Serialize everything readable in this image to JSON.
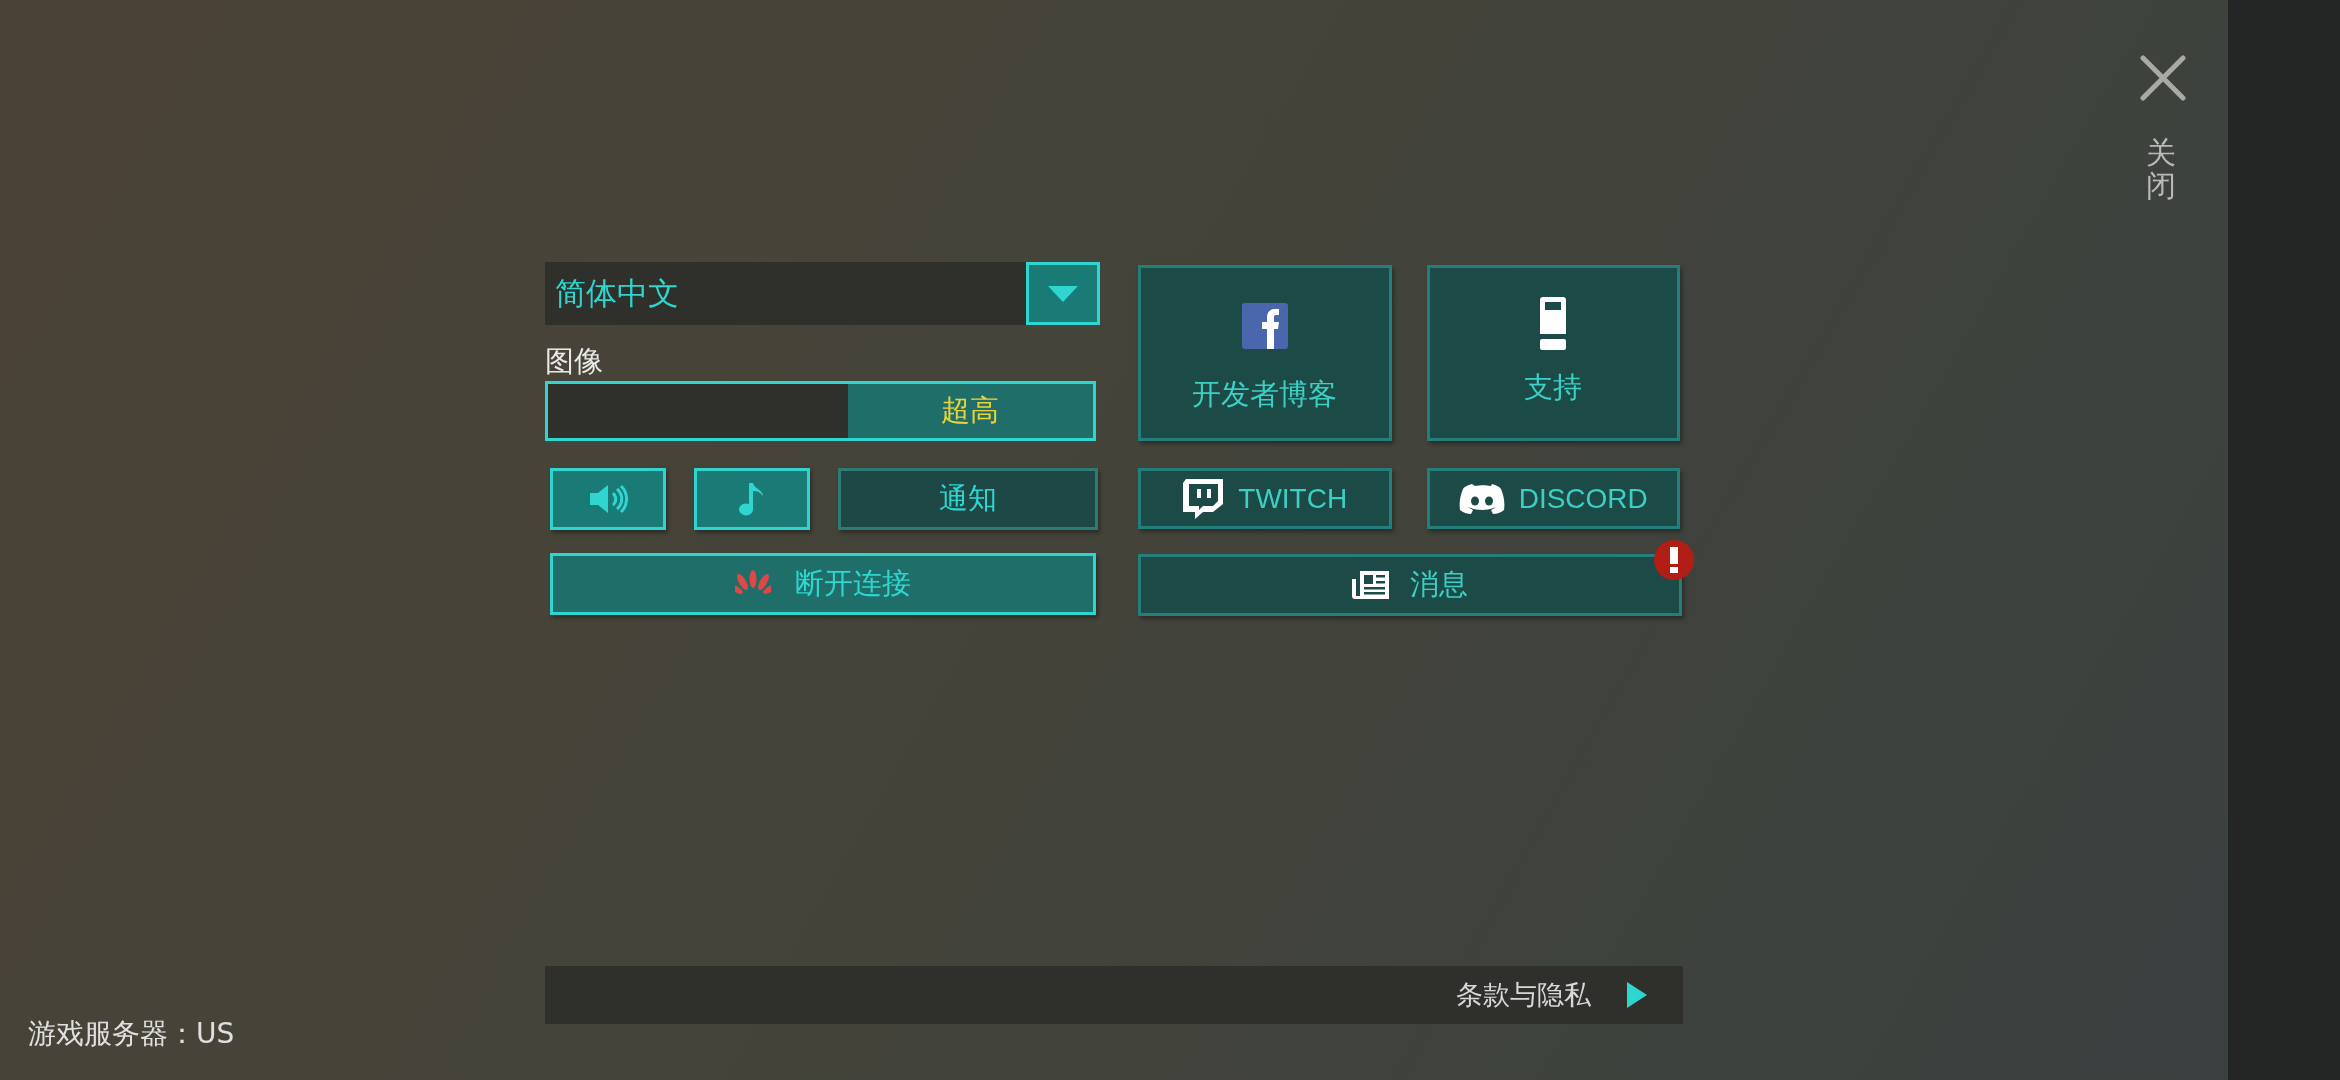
{
  "language_select": {
    "value": "简体中文"
  },
  "graphics": {
    "label": "图像",
    "level": 1,
    "value": "超高"
  },
  "toggles": [
    {
      "kind": "sound",
      "on": true
    },
    {
      "kind": "music",
      "on": true
    },
    {
      "kind": "text",
      "label": "通知",
      "on": false
    }
  ],
  "disconnect_button": {
    "label": "断开连接"
  },
  "tiles": [
    {
      "kind": "facebook",
      "label": "开发者博客"
    },
    {
      "kind": "support",
      "label": "支持"
    }
  ],
  "social": [
    {
      "kind": "twitch",
      "label": "TWITCH"
    },
    {
      "kind": "discord",
      "label": "DISCORD"
    }
  ],
  "news_button": {
    "label": "消息",
    "alert": true
  },
  "close": {
    "label": "关闭"
  },
  "terms_link": {
    "label": "条款与隐私"
  },
  "server": {
    "text": "游戏服务器：US"
  }
}
